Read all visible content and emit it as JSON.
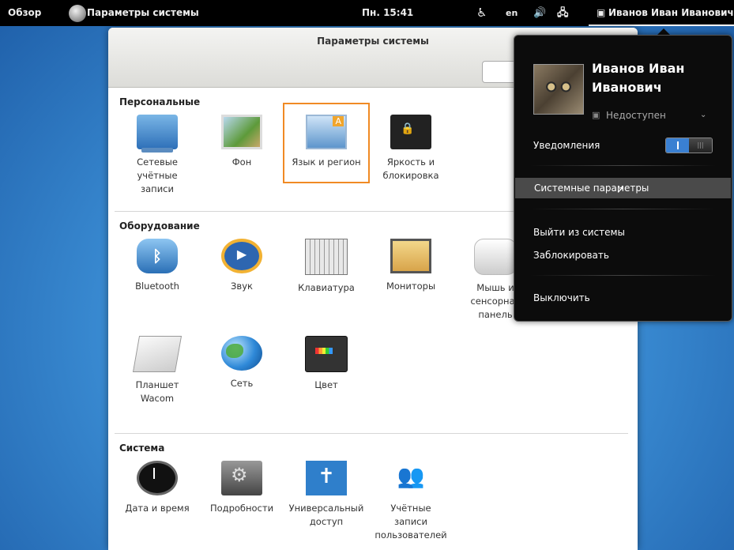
{
  "topbar": {
    "activities": "Обзор",
    "app_name": "Параметры системы",
    "clock": "Пн. 15:41",
    "accessibility_icon": "accessibility-icon",
    "language": "en",
    "volume_icon": "volume-icon",
    "network_icon": "network-icon",
    "user_name": "Иванов Иван Иванович"
  },
  "window": {
    "title": "Параметры системы",
    "search_placeholder": ""
  },
  "sections": {
    "personal": {
      "title": "Персональные",
      "items": [
        {
          "label": "Сетевые\nучётные\nзаписи",
          "icon": "online-accounts-icon"
        },
        {
          "label": "Фон",
          "icon": "background-icon"
        },
        {
          "label": "Язык и регион",
          "icon": "language-region-icon"
        },
        {
          "label": "Яркость и\nблокировка",
          "icon": "brightness-lock-icon"
        }
      ]
    },
    "hardware": {
      "title": "Оборудование",
      "items": [
        {
          "label": "Bluetooth",
          "icon": "bluetooth-icon"
        },
        {
          "label": "Звук",
          "icon": "sound-icon"
        },
        {
          "label": "Клавиатура",
          "icon": "keyboard-icon"
        },
        {
          "label": "Мониторы",
          "icon": "displays-icon"
        },
        {
          "label": "Мышь и\nсенсорная\nпанель",
          "icon": "mouse-icon"
        },
        {
          "label": "Планшет\nWacom",
          "icon": "wacom-icon"
        },
        {
          "label": "Сеть",
          "icon": "network-globe-icon"
        },
        {
          "label": "Цвет",
          "icon": "color-icon"
        }
      ]
    },
    "system": {
      "title": "Система",
      "items": [
        {
          "label": "Дата и время",
          "icon": "clock-icon"
        },
        {
          "label": "Подробности",
          "icon": "details-icon"
        },
        {
          "label": "Универсальный\nдоступ",
          "icon": "universal-access-icon"
        },
        {
          "label": "Учётные\nзаписи\nпользователей",
          "icon": "user-accounts-icon"
        }
      ]
    }
  },
  "user_menu": {
    "full_name": "Иванов Иван Иванович",
    "status": "Недоступен",
    "notifications_label": "Уведомления",
    "notifications_on": true,
    "system_settings": "Системные параметры",
    "logout": "Выйти из системы",
    "lock": "Заблокировать",
    "power_off": "Выключить"
  },
  "colors": {
    "highlight": "#f08a24",
    "toggle_on": "#3a80d2"
  }
}
